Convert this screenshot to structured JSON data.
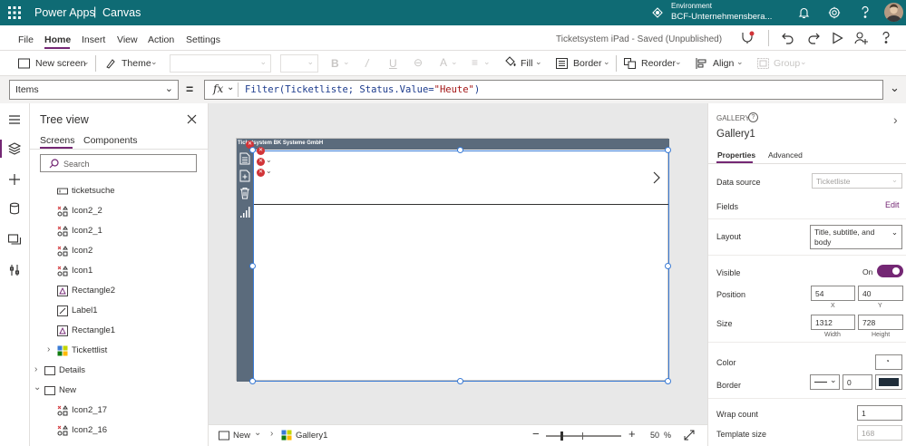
{
  "topbar": {
    "app_name": "Power Apps",
    "separator": "|",
    "product": "Canvas",
    "env_label": "Environment",
    "env_name": "BCF-Unternehmensbera..."
  },
  "menubar": {
    "tabs": [
      "File",
      "Home",
      "Insert",
      "View",
      "Action",
      "Settings"
    ],
    "active_tab": "Home",
    "doc_title": "Ticketsystem iPad - Saved (Unpublished)"
  },
  "cmdbar": {
    "new_screen": "New screen",
    "theme": "Theme",
    "fill": "Fill",
    "border": "Border",
    "reorder": "Reorder",
    "align": "Align",
    "group": "Group"
  },
  "formula": {
    "property": "Items",
    "equals": "=",
    "fx": "fx",
    "expression_fn": "Filter(Ticketliste; Status.Value=",
    "expression_str": "\"Heute\"",
    "expression_end": ")"
  },
  "tree": {
    "title": "Tree view",
    "tabs": [
      "Screens",
      "Components"
    ],
    "search_placeholder": "Search",
    "items": [
      {
        "label": "ticketsuche",
        "icon": "textinput-icon"
      },
      {
        "label": "Icon2_2",
        "icon": "icon-control-icon"
      },
      {
        "label": "Icon2_1",
        "icon": "icon-control-icon"
      },
      {
        "label": "Icon2",
        "icon": "icon-control-icon"
      },
      {
        "label": "Icon1",
        "icon": "icon-control-icon"
      },
      {
        "label": "Rectangle2",
        "icon": "shape-icon"
      },
      {
        "label": "Label1",
        "icon": "label-icon"
      },
      {
        "label": "Rectangle1",
        "icon": "shape-icon"
      },
      {
        "label": "Tickettlist",
        "icon": "gallery-icon"
      },
      {
        "label": "Details",
        "icon": "screen-icon"
      },
      {
        "label": "New",
        "icon": "screen-icon"
      },
      {
        "label": "Icon2_17",
        "icon": "icon-control-icon"
      },
      {
        "label": "Icon2_16",
        "icon": "icon-control-icon"
      }
    ]
  },
  "canvas": {
    "app_header": "Ticketsystem BK Systeme GmbH"
  },
  "statusbar": {
    "screen": "New",
    "control": "Gallery1",
    "zoom": "50",
    "zoom_unit": "%"
  },
  "props": {
    "type_label": "GALLERY",
    "name": "Gallery1",
    "tabs": [
      "Properties",
      "Advanced"
    ],
    "data_source_label": "Data source",
    "data_source_value": "Ticketliste",
    "fields_label": "Fields",
    "fields_action": "Edit",
    "layout_label": "Layout",
    "layout_value": "Title, subtitle, and body",
    "visible_label": "Visible",
    "visible_value": "On",
    "position_label": "Position",
    "pos_x": "54",
    "pos_y": "40",
    "x_label": "X",
    "y_label": "Y",
    "size_label": "Size",
    "width": "1312",
    "height": "728",
    "width_label": "Width",
    "height_label": "Height",
    "color_label": "Color",
    "border_label": "Border",
    "border_width": "0",
    "border_color": "#1f2d3a",
    "wrap_label": "Wrap count",
    "wrap_value": "1",
    "template_label": "Template size",
    "template_value": "168"
  },
  "colors": {
    "brand": "#0f6b74",
    "accent": "#742774",
    "selection": "#3a7bd5",
    "header_bar": "#5b6b7c"
  }
}
